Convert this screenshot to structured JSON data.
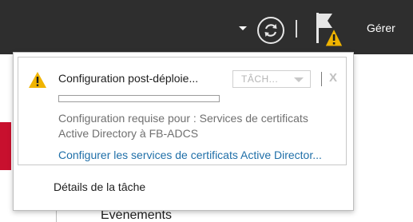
{
  "toolbar": {
    "manage_label": "Gérer",
    "icons": [
      "dropdown-arrow-icon",
      "refresh-icon",
      "flag-warning-icon"
    ]
  },
  "background": {
    "events_label": "Événements"
  },
  "notification": {
    "title": "Configuration post-déploie...",
    "task_button": "TÂCH...",
    "close_glyph": "X",
    "progress": 0,
    "description_line1": "Configuration requise pour : Services de certificats",
    "description_line2": "Active Directory à FB-ADCS",
    "link": "Configurer les services de certificats Active Director..."
  },
  "footer": {
    "task_details": "Détails de la tâche"
  },
  "colors": {
    "toolbar_bg": "#2e2e2e",
    "warning": "#f0b400",
    "link": "#1f6fa8",
    "accent_red": "#c8102e"
  }
}
